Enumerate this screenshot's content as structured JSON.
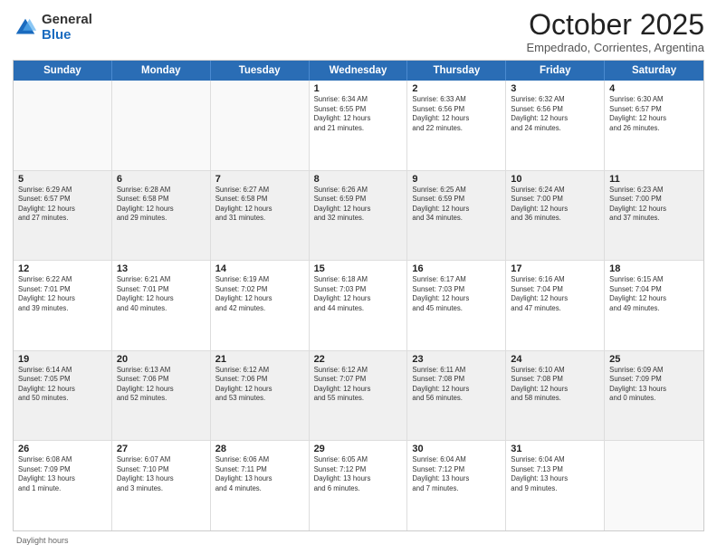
{
  "logo": {
    "general": "General",
    "blue": "Blue"
  },
  "title": "October 2025",
  "subtitle": "Empedrado, Corrientes, Argentina",
  "days_of_week": [
    "Sunday",
    "Monday",
    "Tuesday",
    "Wednesday",
    "Thursday",
    "Friday",
    "Saturday"
  ],
  "footer": "Daylight hours",
  "weeks": [
    [
      {
        "day": "",
        "info": "",
        "empty": true
      },
      {
        "day": "",
        "info": "",
        "empty": true
      },
      {
        "day": "",
        "info": "",
        "empty": true
      },
      {
        "day": "1",
        "info": "Sunrise: 6:34 AM\nSunset: 6:55 PM\nDaylight: 12 hours\nand 21 minutes."
      },
      {
        "day": "2",
        "info": "Sunrise: 6:33 AM\nSunset: 6:56 PM\nDaylight: 12 hours\nand 22 minutes."
      },
      {
        "day": "3",
        "info": "Sunrise: 6:32 AM\nSunset: 6:56 PM\nDaylight: 12 hours\nand 24 minutes."
      },
      {
        "day": "4",
        "info": "Sunrise: 6:30 AM\nSunset: 6:57 PM\nDaylight: 12 hours\nand 26 minutes."
      }
    ],
    [
      {
        "day": "5",
        "info": "Sunrise: 6:29 AM\nSunset: 6:57 PM\nDaylight: 12 hours\nand 27 minutes.",
        "shaded": true
      },
      {
        "day": "6",
        "info": "Sunrise: 6:28 AM\nSunset: 6:58 PM\nDaylight: 12 hours\nand 29 minutes.",
        "shaded": true
      },
      {
        "day": "7",
        "info": "Sunrise: 6:27 AM\nSunset: 6:58 PM\nDaylight: 12 hours\nand 31 minutes.",
        "shaded": true
      },
      {
        "day": "8",
        "info": "Sunrise: 6:26 AM\nSunset: 6:59 PM\nDaylight: 12 hours\nand 32 minutes.",
        "shaded": true
      },
      {
        "day": "9",
        "info": "Sunrise: 6:25 AM\nSunset: 6:59 PM\nDaylight: 12 hours\nand 34 minutes.",
        "shaded": true
      },
      {
        "day": "10",
        "info": "Sunrise: 6:24 AM\nSunset: 7:00 PM\nDaylight: 12 hours\nand 36 minutes.",
        "shaded": true
      },
      {
        "day": "11",
        "info": "Sunrise: 6:23 AM\nSunset: 7:00 PM\nDaylight: 12 hours\nand 37 minutes.",
        "shaded": true
      }
    ],
    [
      {
        "day": "12",
        "info": "Sunrise: 6:22 AM\nSunset: 7:01 PM\nDaylight: 12 hours\nand 39 minutes."
      },
      {
        "day": "13",
        "info": "Sunrise: 6:21 AM\nSunset: 7:01 PM\nDaylight: 12 hours\nand 40 minutes."
      },
      {
        "day": "14",
        "info": "Sunrise: 6:19 AM\nSunset: 7:02 PM\nDaylight: 12 hours\nand 42 minutes."
      },
      {
        "day": "15",
        "info": "Sunrise: 6:18 AM\nSunset: 7:03 PM\nDaylight: 12 hours\nand 44 minutes."
      },
      {
        "day": "16",
        "info": "Sunrise: 6:17 AM\nSunset: 7:03 PM\nDaylight: 12 hours\nand 45 minutes."
      },
      {
        "day": "17",
        "info": "Sunrise: 6:16 AM\nSunset: 7:04 PM\nDaylight: 12 hours\nand 47 minutes."
      },
      {
        "day": "18",
        "info": "Sunrise: 6:15 AM\nSunset: 7:04 PM\nDaylight: 12 hours\nand 49 minutes."
      }
    ],
    [
      {
        "day": "19",
        "info": "Sunrise: 6:14 AM\nSunset: 7:05 PM\nDaylight: 12 hours\nand 50 minutes.",
        "shaded": true
      },
      {
        "day": "20",
        "info": "Sunrise: 6:13 AM\nSunset: 7:06 PM\nDaylight: 12 hours\nand 52 minutes.",
        "shaded": true
      },
      {
        "day": "21",
        "info": "Sunrise: 6:12 AM\nSunset: 7:06 PM\nDaylight: 12 hours\nand 53 minutes.",
        "shaded": true
      },
      {
        "day": "22",
        "info": "Sunrise: 6:12 AM\nSunset: 7:07 PM\nDaylight: 12 hours\nand 55 minutes.",
        "shaded": true
      },
      {
        "day": "23",
        "info": "Sunrise: 6:11 AM\nSunset: 7:08 PM\nDaylight: 12 hours\nand 56 minutes.",
        "shaded": true
      },
      {
        "day": "24",
        "info": "Sunrise: 6:10 AM\nSunset: 7:08 PM\nDaylight: 12 hours\nand 58 minutes.",
        "shaded": true
      },
      {
        "day": "25",
        "info": "Sunrise: 6:09 AM\nSunset: 7:09 PM\nDaylight: 13 hours\nand 0 minutes.",
        "shaded": true
      }
    ],
    [
      {
        "day": "26",
        "info": "Sunrise: 6:08 AM\nSunset: 7:09 PM\nDaylight: 13 hours\nand 1 minute."
      },
      {
        "day": "27",
        "info": "Sunrise: 6:07 AM\nSunset: 7:10 PM\nDaylight: 13 hours\nand 3 minutes."
      },
      {
        "day": "28",
        "info": "Sunrise: 6:06 AM\nSunset: 7:11 PM\nDaylight: 13 hours\nand 4 minutes."
      },
      {
        "day": "29",
        "info": "Sunrise: 6:05 AM\nSunset: 7:12 PM\nDaylight: 13 hours\nand 6 minutes."
      },
      {
        "day": "30",
        "info": "Sunrise: 6:04 AM\nSunset: 7:12 PM\nDaylight: 13 hours\nand 7 minutes."
      },
      {
        "day": "31",
        "info": "Sunrise: 6:04 AM\nSunset: 7:13 PM\nDaylight: 13 hours\nand 9 minutes."
      },
      {
        "day": "",
        "info": "",
        "empty": true
      }
    ]
  ]
}
